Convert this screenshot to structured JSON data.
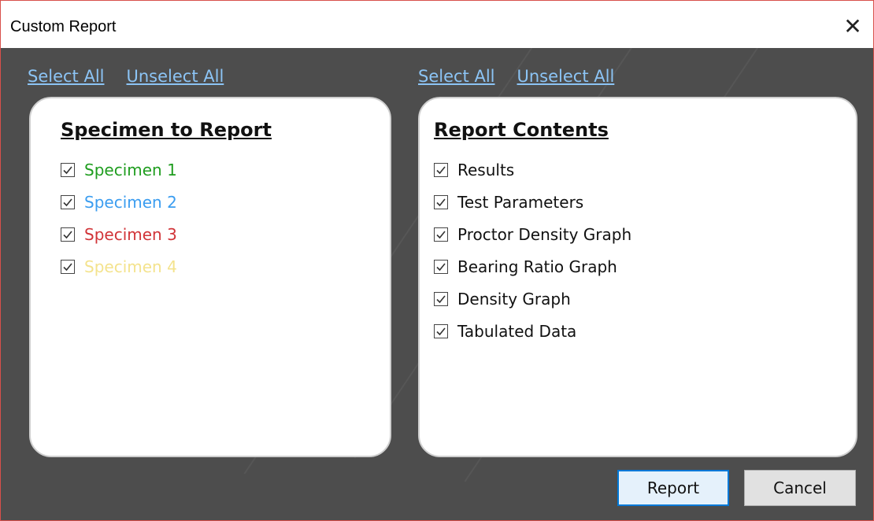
{
  "window": {
    "title": "Custom Report",
    "close_glyph": "✕"
  },
  "left_links": {
    "select_all": "Select All",
    "unselect_all": "Unselect All"
  },
  "right_links": {
    "select_all": "Select All",
    "unselect_all": "Unselect All"
  },
  "specimen_panel": {
    "title": "Specimen to Report",
    "items": [
      {
        "label": "Specimen 1",
        "checked": true,
        "color": "#1f9d1f"
      },
      {
        "label": "Specimen 2",
        "checked": true,
        "color": "#3b9df0"
      },
      {
        "label": "Specimen 3",
        "checked": true,
        "color": "#d13438"
      },
      {
        "label": "Specimen 4",
        "checked": true,
        "color": "#f4e38d"
      }
    ]
  },
  "contents_panel": {
    "title": "Report Contents",
    "items": [
      {
        "label": "Results",
        "checked": true
      },
      {
        "label": "Test Parameters",
        "checked": true
      },
      {
        "label": "Proctor Density Graph",
        "checked": true
      },
      {
        "label": "Bearing Ratio Graph",
        "checked": true
      },
      {
        "label": "Density Graph",
        "checked": true
      },
      {
        "label": "Tabulated Data",
        "checked": true
      }
    ]
  },
  "buttons": {
    "report": "Report",
    "cancel": "Cancel"
  },
  "colors": {
    "window_border": "#d8504b",
    "client_background": "#4d4d4d",
    "link": "#8cc4f5",
    "default_button_border": "#0078d7"
  }
}
